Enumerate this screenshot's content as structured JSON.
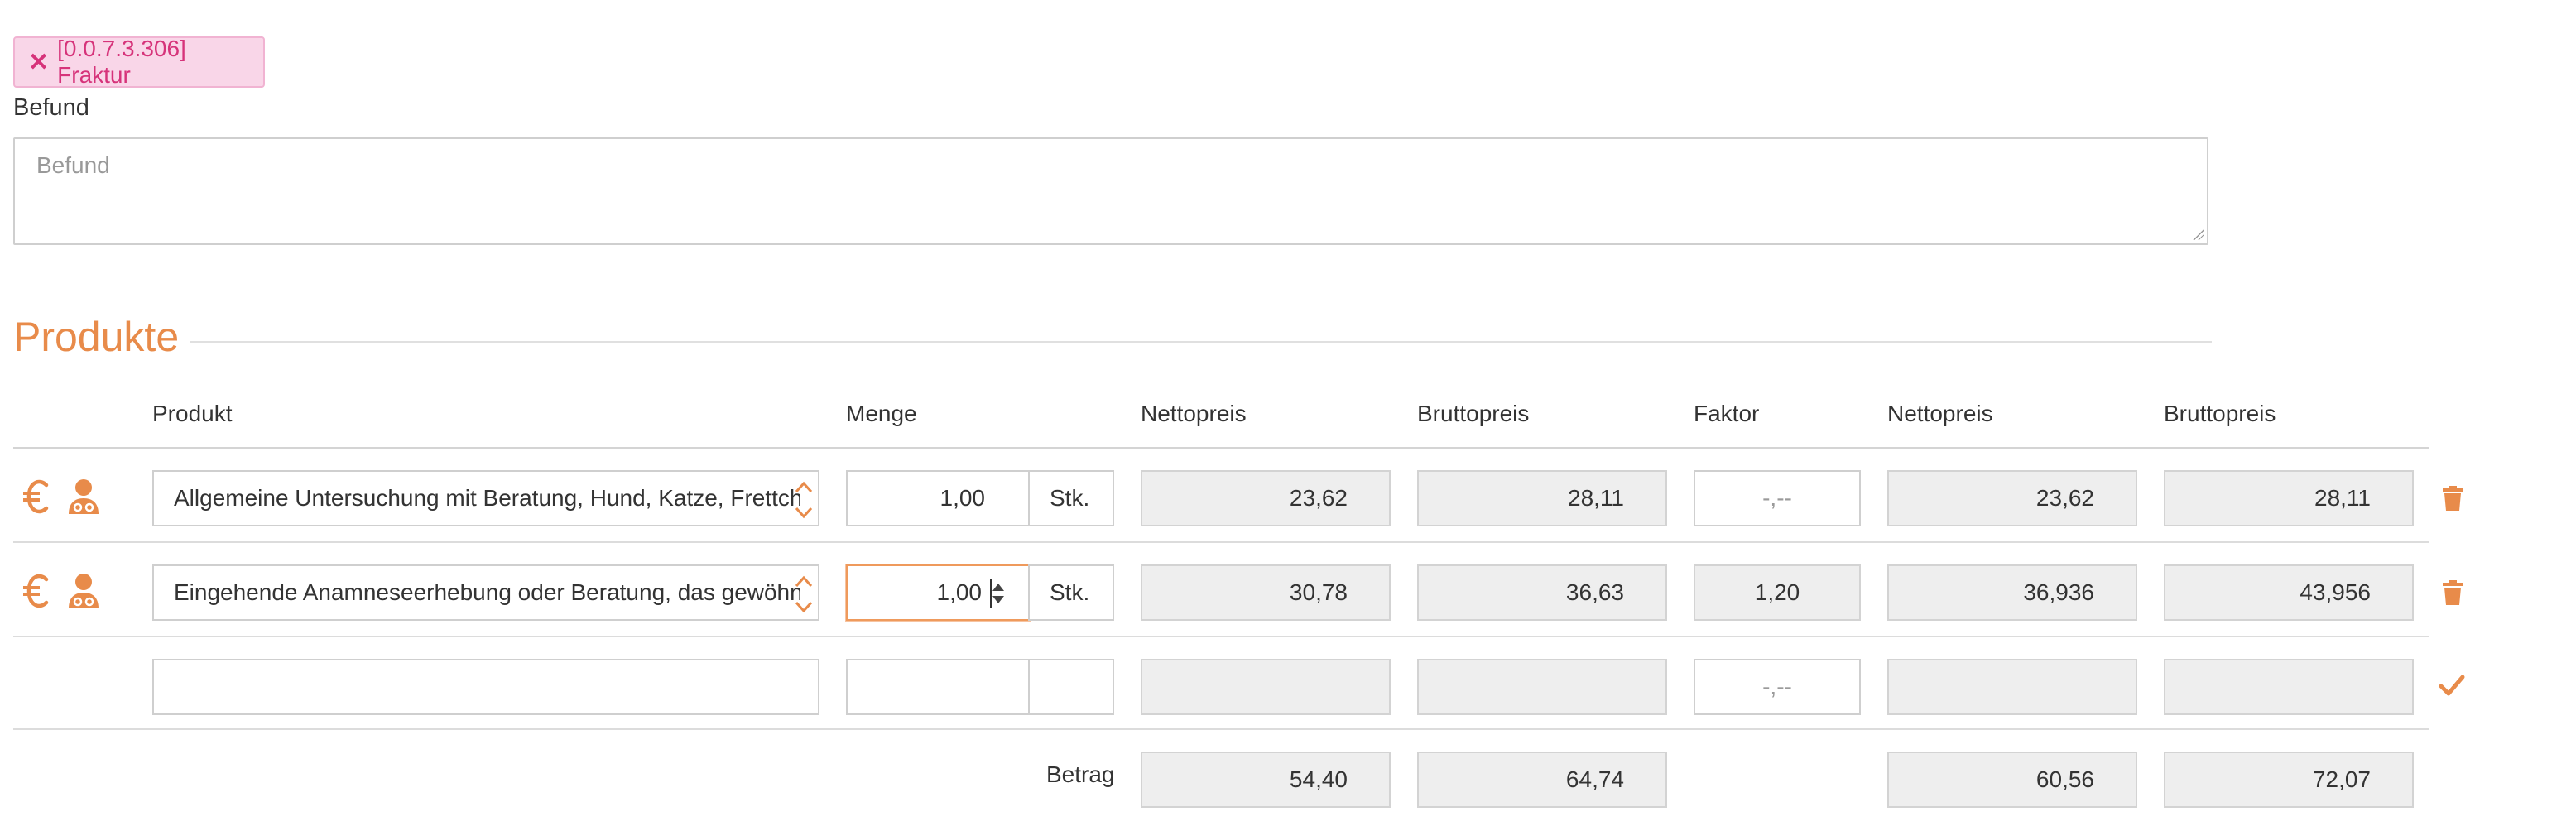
{
  "tag": {
    "close_glyph": "✕",
    "label": "[0.0.7.3.306] Fraktur"
  },
  "befund": {
    "label": "Befund",
    "placeholder": "Befund"
  },
  "section": {
    "title": "Produkte"
  },
  "headers": {
    "produkt": "Produkt",
    "menge": "Menge",
    "nettopreis1": "Nettopreis",
    "bruttopreis1": "Bruttopreis",
    "faktor": "Faktor",
    "nettopreis2": "Nettopreis",
    "bruttopreis2": "Bruttopreis"
  },
  "rows": [
    {
      "product": "Allgemeine Untersuchung mit Beratung, Hund, Katze, Frettchen",
      "qty": "1,00",
      "unit": "Stk.",
      "net": "23,62",
      "gross": "28,11",
      "factor": "-,--",
      "net_total": "23,62",
      "gross_total": "28,11"
    },
    {
      "product": "Eingehende Anamneseerhebung oder Beratung, das gewöhnliche Maß übersteigend",
      "qty": "1,00",
      "unit": "Stk.",
      "net": "30,78",
      "gross": "36,63",
      "factor": "1,20",
      "net_total": "36,936",
      "gross_total": "43,956"
    },
    {
      "factor": "-,--"
    }
  ],
  "totals": {
    "label": "Betrag",
    "net": "54,40",
    "gross": "64,74",
    "net_total": "60,56",
    "gross_total": "72,07"
  },
  "colors": {
    "accent": "#e88b4a",
    "tag_bg": "#f9d6e8",
    "tag_text": "#d6337a"
  },
  "icons": [
    "close-icon",
    "euro-icon",
    "vet-person-icon",
    "trash-icon",
    "check-icon",
    "chevron-up-down-icon",
    "spinner-icon"
  ]
}
